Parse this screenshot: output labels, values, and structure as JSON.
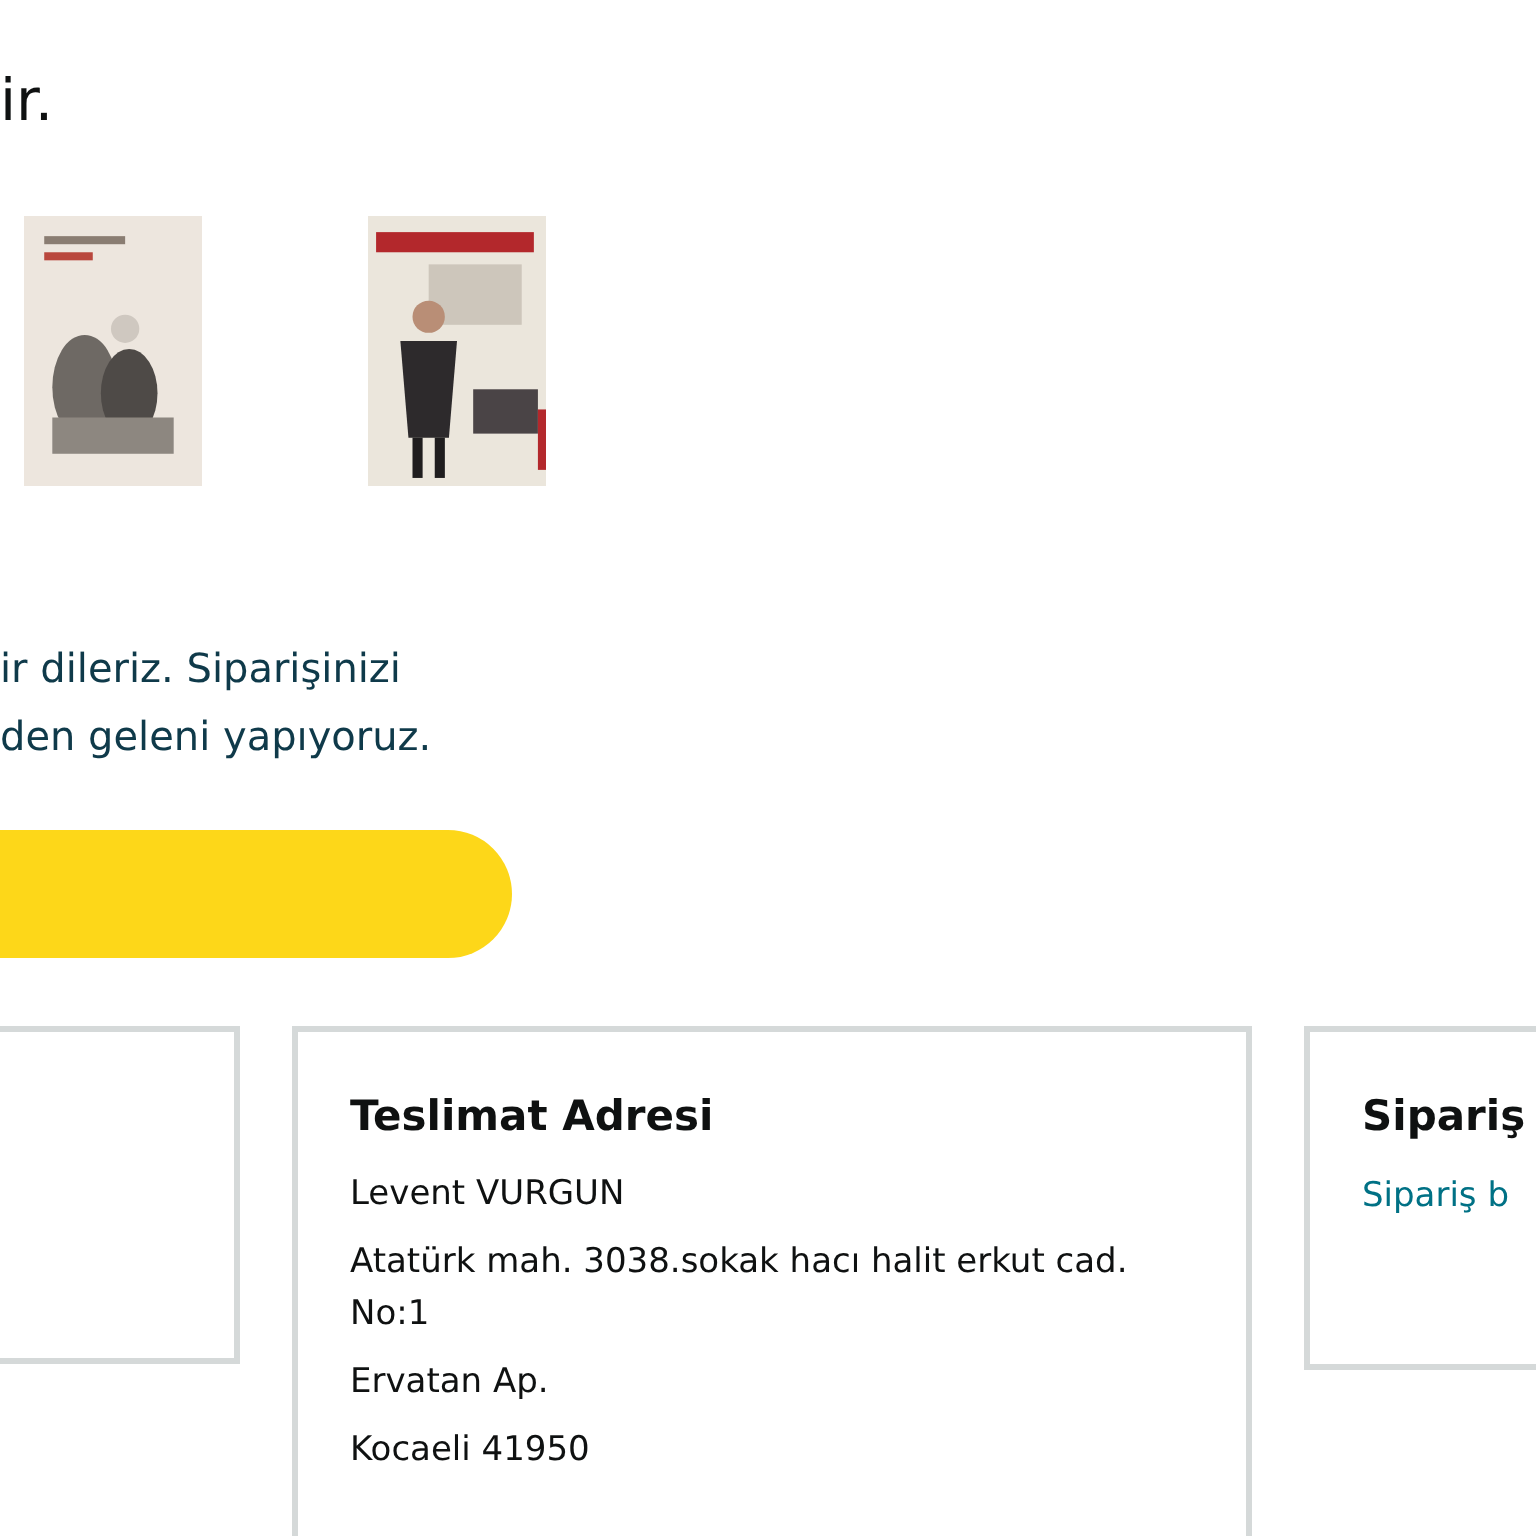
{
  "heading": "ir.",
  "books": [
    {
      "kind": "picture"
    },
    {
      "kind": "picture"
    }
  ],
  "message": [
    "ir dileriz. Siparişinizi",
    "den geleni yapıyoruz."
  ],
  "button": {
    "kind": "primary"
  },
  "cards": [
    {
      "kind": "empty"
    },
    {
      "title": "Teslimat Adresi",
      "lines": [
        "Levent VURGUN",
        "Atatürk mah. 3038.sokak hacı halit erkut cad. No:1",
        "Ervatan Ap.",
        "Kocaeli 41950"
      ]
    },
    {
      "title": "Sipariş",
      "link": "Sipariş b"
    }
  ]
}
